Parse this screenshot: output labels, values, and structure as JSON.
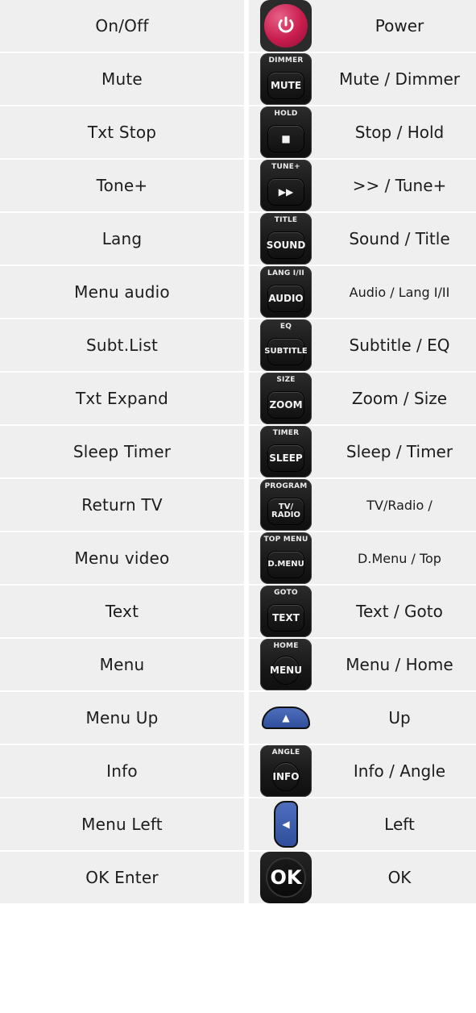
{
  "rows": [
    {
      "left": "On/Off",
      "right": "Power",
      "button": {
        "top": "",
        "cap": "",
        "kind": "power-icon"
      }
    },
    {
      "left": "Mute",
      "right": "Mute / Dimmer",
      "button": {
        "top": "DIMMER",
        "cap": "MUTE",
        "kind": "mute-button-icon"
      }
    },
    {
      "left": "Txt Stop",
      "right": "Stop / Hold",
      "button": {
        "top": "HOLD",
        "cap": "■",
        "kind": "stop-button-icon"
      }
    },
    {
      "left": "Tone+",
      "right": ">> / Tune+",
      "button": {
        "top": "TUNE+",
        "cap": "▶▶",
        "kind": "fast-forward-icon"
      }
    },
    {
      "left": "Lang",
      "right": "Sound / Title",
      "button": {
        "top": "TITLE",
        "cap": "SOUND",
        "kind": "sound-button-icon"
      }
    },
    {
      "left": "Menu audio",
      "right": "Audio / Lang I/II",
      "button": {
        "top": "LANG I/II",
        "cap": "AUDIO",
        "kind": "audio-button-icon"
      }
    },
    {
      "left": "Subt.List",
      "right": "Subtitle / EQ",
      "button": {
        "top": "EQ",
        "cap": "SUBTITLE",
        "kind": "subtitle-button-icon"
      }
    },
    {
      "left": "Txt Expand",
      "right": "Zoom / Size",
      "button": {
        "top": "SIZE",
        "cap": "ZOOM",
        "kind": "zoom-button-icon"
      }
    },
    {
      "left": "Sleep Timer",
      "right": "Sleep / Timer",
      "button": {
        "top": "TIMER",
        "cap": "SLEEP",
        "kind": "sleep-button-icon"
      }
    },
    {
      "left": "Return TV",
      "right": "TV/Radio /",
      "button": {
        "top": "PROGRAM",
        "cap": "TV/\nRADIO",
        "kind": "tv-radio-button-icon"
      }
    },
    {
      "left": "Menu video",
      "right": "D.Menu / Top",
      "button": {
        "top": "TOP MENU",
        "cap": "D.MENU",
        "kind": "dmenu-button-icon"
      }
    },
    {
      "left": "Text",
      "right": "Text / Goto",
      "button": {
        "top": "GOTO",
        "cap": "TEXT",
        "kind": "text-button-icon"
      }
    },
    {
      "left": "Menu",
      "right": "Menu / Home",
      "button": {
        "top": "HOME",
        "cap": "MENU",
        "kind": "menu-button-icon"
      }
    },
    {
      "left": "Menu Up",
      "right": "Up",
      "button": {
        "top": "",
        "cap": "▲",
        "kind": "up-arrow-icon"
      }
    },
    {
      "left": "Info",
      "right": "Info / Angle",
      "button": {
        "top": "ANGLE",
        "cap": "INFO",
        "kind": "info-button-icon"
      }
    },
    {
      "left": "Menu Left",
      "right": "Left",
      "button": {
        "top": "",
        "cap": "◀",
        "kind": "left-arrow-icon"
      }
    },
    {
      "left": "OK Enter",
      "right": "OK",
      "button": {
        "top": "",
        "cap": "OK",
        "kind": "ok-button-icon"
      }
    }
  ],
  "colors": {
    "cell_bg": "#efefef",
    "text": "#1c1c1c",
    "accent_red": "#c81c4d",
    "accent_blue": "#2f4f9c",
    "button_dark": "#171717"
  }
}
